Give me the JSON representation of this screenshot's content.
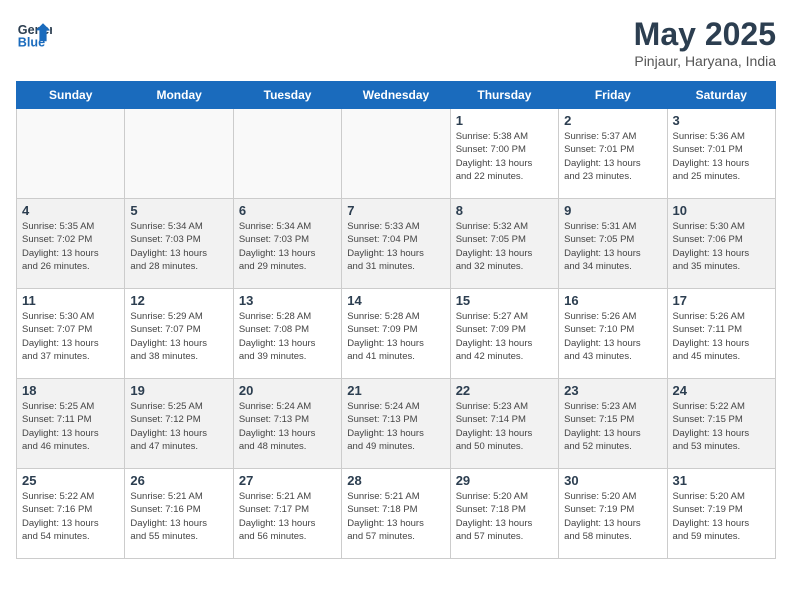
{
  "header": {
    "logo_line1": "General",
    "logo_line2": "Blue",
    "title": "May 2025",
    "location": "Pinjaur, Haryana, India"
  },
  "weekdays": [
    "Sunday",
    "Monday",
    "Tuesday",
    "Wednesday",
    "Thursday",
    "Friday",
    "Saturday"
  ],
  "weeks": [
    [
      {
        "day": "",
        "info": ""
      },
      {
        "day": "",
        "info": ""
      },
      {
        "day": "",
        "info": ""
      },
      {
        "day": "",
        "info": ""
      },
      {
        "day": "1",
        "info": "Sunrise: 5:38 AM\nSunset: 7:00 PM\nDaylight: 13 hours\nand 22 minutes."
      },
      {
        "day": "2",
        "info": "Sunrise: 5:37 AM\nSunset: 7:01 PM\nDaylight: 13 hours\nand 23 minutes."
      },
      {
        "day": "3",
        "info": "Sunrise: 5:36 AM\nSunset: 7:01 PM\nDaylight: 13 hours\nand 25 minutes."
      }
    ],
    [
      {
        "day": "4",
        "info": "Sunrise: 5:35 AM\nSunset: 7:02 PM\nDaylight: 13 hours\nand 26 minutes."
      },
      {
        "day": "5",
        "info": "Sunrise: 5:34 AM\nSunset: 7:03 PM\nDaylight: 13 hours\nand 28 minutes."
      },
      {
        "day": "6",
        "info": "Sunrise: 5:34 AM\nSunset: 7:03 PM\nDaylight: 13 hours\nand 29 minutes."
      },
      {
        "day": "7",
        "info": "Sunrise: 5:33 AM\nSunset: 7:04 PM\nDaylight: 13 hours\nand 31 minutes."
      },
      {
        "day": "8",
        "info": "Sunrise: 5:32 AM\nSunset: 7:05 PM\nDaylight: 13 hours\nand 32 minutes."
      },
      {
        "day": "9",
        "info": "Sunrise: 5:31 AM\nSunset: 7:05 PM\nDaylight: 13 hours\nand 34 minutes."
      },
      {
        "day": "10",
        "info": "Sunrise: 5:30 AM\nSunset: 7:06 PM\nDaylight: 13 hours\nand 35 minutes."
      }
    ],
    [
      {
        "day": "11",
        "info": "Sunrise: 5:30 AM\nSunset: 7:07 PM\nDaylight: 13 hours\nand 37 minutes."
      },
      {
        "day": "12",
        "info": "Sunrise: 5:29 AM\nSunset: 7:07 PM\nDaylight: 13 hours\nand 38 minutes."
      },
      {
        "day": "13",
        "info": "Sunrise: 5:28 AM\nSunset: 7:08 PM\nDaylight: 13 hours\nand 39 minutes."
      },
      {
        "day": "14",
        "info": "Sunrise: 5:28 AM\nSunset: 7:09 PM\nDaylight: 13 hours\nand 41 minutes."
      },
      {
        "day": "15",
        "info": "Sunrise: 5:27 AM\nSunset: 7:09 PM\nDaylight: 13 hours\nand 42 minutes."
      },
      {
        "day": "16",
        "info": "Sunrise: 5:26 AM\nSunset: 7:10 PM\nDaylight: 13 hours\nand 43 minutes."
      },
      {
        "day": "17",
        "info": "Sunrise: 5:26 AM\nSunset: 7:11 PM\nDaylight: 13 hours\nand 45 minutes."
      }
    ],
    [
      {
        "day": "18",
        "info": "Sunrise: 5:25 AM\nSunset: 7:11 PM\nDaylight: 13 hours\nand 46 minutes."
      },
      {
        "day": "19",
        "info": "Sunrise: 5:25 AM\nSunset: 7:12 PM\nDaylight: 13 hours\nand 47 minutes."
      },
      {
        "day": "20",
        "info": "Sunrise: 5:24 AM\nSunset: 7:13 PM\nDaylight: 13 hours\nand 48 minutes."
      },
      {
        "day": "21",
        "info": "Sunrise: 5:24 AM\nSunset: 7:13 PM\nDaylight: 13 hours\nand 49 minutes."
      },
      {
        "day": "22",
        "info": "Sunrise: 5:23 AM\nSunset: 7:14 PM\nDaylight: 13 hours\nand 50 minutes."
      },
      {
        "day": "23",
        "info": "Sunrise: 5:23 AM\nSunset: 7:15 PM\nDaylight: 13 hours\nand 52 minutes."
      },
      {
        "day": "24",
        "info": "Sunrise: 5:22 AM\nSunset: 7:15 PM\nDaylight: 13 hours\nand 53 minutes."
      }
    ],
    [
      {
        "day": "25",
        "info": "Sunrise: 5:22 AM\nSunset: 7:16 PM\nDaylight: 13 hours\nand 54 minutes."
      },
      {
        "day": "26",
        "info": "Sunrise: 5:21 AM\nSunset: 7:16 PM\nDaylight: 13 hours\nand 55 minutes."
      },
      {
        "day": "27",
        "info": "Sunrise: 5:21 AM\nSunset: 7:17 PM\nDaylight: 13 hours\nand 56 minutes."
      },
      {
        "day": "28",
        "info": "Sunrise: 5:21 AM\nSunset: 7:18 PM\nDaylight: 13 hours\nand 57 minutes."
      },
      {
        "day": "29",
        "info": "Sunrise: 5:20 AM\nSunset: 7:18 PM\nDaylight: 13 hours\nand 57 minutes."
      },
      {
        "day": "30",
        "info": "Sunrise: 5:20 AM\nSunset: 7:19 PM\nDaylight: 13 hours\nand 58 minutes."
      },
      {
        "day": "31",
        "info": "Sunrise: 5:20 AM\nSunset: 7:19 PM\nDaylight: 13 hours\nand 59 minutes."
      }
    ]
  ]
}
